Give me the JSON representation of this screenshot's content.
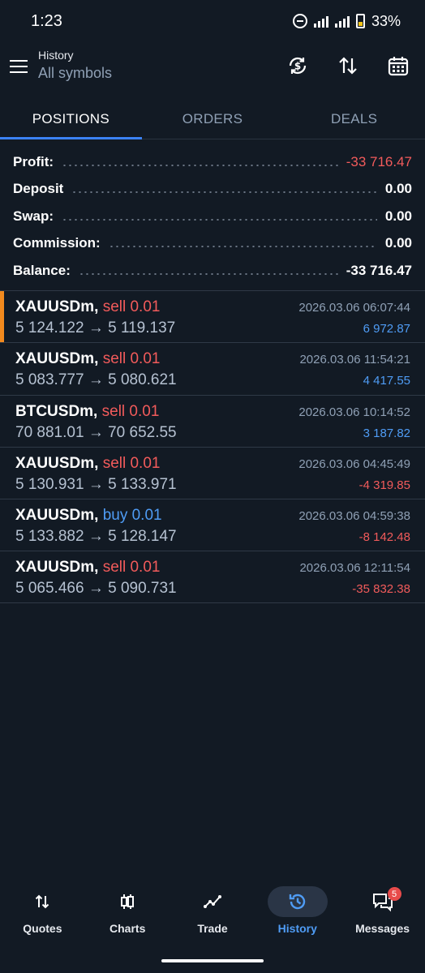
{
  "status_bar": {
    "time": "1:23",
    "battery": "33%"
  },
  "header": {
    "title": "History",
    "subtitle": "All symbols",
    "icons": [
      "currency-exchange-icon",
      "sort-icon",
      "calendar-icon"
    ]
  },
  "tabs": [
    {
      "label": "POSITIONS",
      "active": true
    },
    {
      "label": "ORDERS",
      "active": false
    },
    {
      "label": "DEALS",
      "active": false
    }
  ],
  "summary": {
    "profit_label": "Profit:",
    "profit_value": "-33 716.47",
    "deposit_label": "Deposit",
    "deposit_value": "0.00",
    "swap_label": "Swap:",
    "swap_value": "0.00",
    "commission_label": "Commission:",
    "commission_value": "0.00",
    "balance_label": "Balance:",
    "balance_value": "-33 716.47"
  },
  "deals": [
    {
      "symbol": "XAUUSDm,",
      "direction": "sell",
      "volume": "sell 0.01",
      "open": "5 124.122",
      "arrow": "→",
      "close": "5 119.137",
      "time": "2026.03.06 06:07:44",
      "profit": "6 972.87"
    },
    {
      "symbol": "XAUUSDm,",
      "direction": "sell",
      "volume": "sell 0.01",
      "open": "5 083.777",
      "arrow": "→",
      "close": "5 080.621",
      "time": "2026.03.06 11:54:21",
      "profit": "4 417.55"
    },
    {
      "symbol": "BTCUSDm,",
      "direction": "sell",
      "volume": "sell 0.01",
      "open": "70 881.01",
      "arrow": "→",
      "close": "70 652.55",
      "time": "2026.03.06 10:14:52",
      "profit": "3 187.82"
    },
    {
      "symbol": "XAUUSDm,",
      "direction": "sell",
      "volume": "sell 0.01",
      "open": "5 130.931",
      "arrow": "→",
      "close": "5 133.971",
      "time": "2026.03.06 04:45:49",
      "profit": "-4 319.85"
    },
    {
      "symbol": "XAUUSDm,",
      "direction": "buy",
      "volume": "buy 0.01",
      "open": "5 133.882",
      "arrow": "→",
      "close": "5 128.147",
      "time": "2026.03.06 04:59:38",
      "profit": "-8 142.48"
    },
    {
      "symbol": "XAUUSDm,",
      "direction": "sell",
      "volume": "sell 0.01",
      "open": "5 065.466",
      "arrow": "→",
      "close": "5 090.731",
      "time": "2026.03.06 12:11:54",
      "profit": "-35 832.38"
    }
  ],
  "nav": [
    {
      "label": "Quotes",
      "icon": "quotes-arrows-icon",
      "active": false
    },
    {
      "label": "Charts",
      "icon": "candlestick-icon",
      "active": false
    },
    {
      "label": "Trade",
      "icon": "trend-line-icon",
      "active": false
    },
    {
      "label": "History",
      "icon": "history-clock-icon",
      "active": true
    },
    {
      "label": "Messages",
      "icon": "chat-bubbles-icon",
      "active": false,
      "badge": "5"
    }
  ],
  "colors": {
    "background": "#121a24",
    "accent_blue": "#4f9cf5",
    "negative_red": "#f25b5b",
    "selected_orange": "#f28a1e"
  }
}
